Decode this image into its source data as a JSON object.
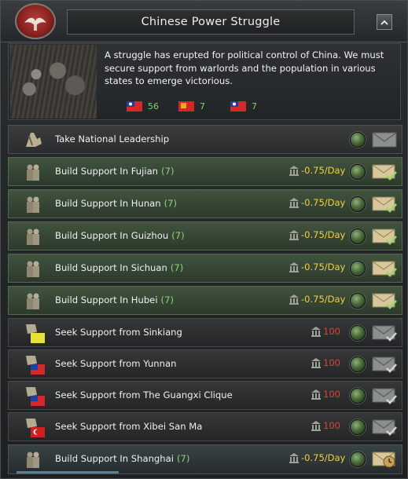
{
  "header": {
    "title": "Chinese Power Struggle",
    "emblem_icon": "faction-emblem-icon",
    "collapse_icon": "chevron-up-icon"
  },
  "description": {
    "text": "A struggle has erupted for political control of China. We must secure support from warlords and the population in various states to emerge victorious.",
    "stats": [
      {
        "flag": "roc-flag-icon",
        "value": "56"
      },
      {
        "flag": "communist-flag-icon",
        "value": "7"
      },
      {
        "flag": "roc-flag-icon",
        "value": "7"
      }
    ]
  },
  "colors": {
    "row_green": "#41533f",
    "row_gray": "#3a3c3d",
    "cost_yellow": "#f1d13e",
    "cost_red": "#e0413a",
    "days_green": "#8fd37a"
  },
  "decisions": [
    {
      "label": "Take National Leadership",
      "days": "",
      "cost": "",
      "cost_color": "",
      "icon": "leader-icon",
      "style": "gray",
      "status": "available-icon",
      "envelope": "envelope-icon"
    },
    {
      "label": "Build Support In Fujian",
      "days": "(7)",
      "cost": "-0.75/Day",
      "cost_color": "yellow",
      "icon": "soldiers-icon",
      "style": "green",
      "status": "available-icon",
      "envelope": "envelope-checked-icon"
    },
    {
      "label": "Build Support In Hunan",
      "days": "(7)",
      "cost": "-0.75/Day",
      "cost_color": "yellow",
      "icon": "soldiers-icon",
      "style": "green",
      "status": "available-icon",
      "envelope": "envelope-checked-icon"
    },
    {
      "label": "Build Support In Guizhou",
      "days": "(7)",
      "cost": "-0.75/Day",
      "cost_color": "yellow",
      "icon": "soldiers-icon",
      "style": "green",
      "status": "available-icon",
      "envelope": "envelope-checked-icon"
    },
    {
      "label": "Build Support In Sichuan",
      "days": "(7)",
      "cost": "-0.75/Day",
      "cost_color": "yellow",
      "icon": "soldiers-icon",
      "style": "green",
      "status": "available-icon",
      "envelope": "envelope-checked-icon"
    },
    {
      "label": "Build Support In Hubei",
      "days": "(7)",
      "cost": "-0.75/Day",
      "cost_color": "yellow",
      "icon": "soldiers-icon",
      "style": "green",
      "status": "available-icon",
      "envelope": "envelope-checked-icon"
    },
    {
      "label": "Seek Support from Sinkiang",
      "days": "",
      "cost": "100",
      "cost_color": "red",
      "icon": "fist-sinkiang-flag-icon",
      "style": "dark",
      "status": "available-icon",
      "envelope": "envelope-checked-icon"
    },
    {
      "label": "Seek Support from Yunnan",
      "days": "",
      "cost": "100",
      "cost_color": "red",
      "icon": "fist-yunnan-flag-icon",
      "style": "dark",
      "status": "available-icon",
      "envelope": "envelope-checked-icon"
    },
    {
      "label": "Seek Support from The Guangxi Clique",
      "days": "",
      "cost": "100",
      "cost_color": "red",
      "icon": "fist-guangxi-flag-icon",
      "style": "dark",
      "status": "available-icon",
      "envelope": "envelope-checked-icon"
    },
    {
      "label": "Seek Support from Xibei San Ma",
      "days": "",
      "cost": "100",
      "cost_color": "red",
      "icon": "fist-xibei-flag-icon",
      "style": "dark",
      "status": "available-icon",
      "envelope": "envelope-checked-icon"
    },
    {
      "label": "Build Support In Shanghai",
      "days": "(7)",
      "cost": "-0.75/Day",
      "cost_color": "yellow",
      "icon": "soldiers-icon",
      "style": "blue",
      "status": "available-icon",
      "envelope": "envelope-clock-icon",
      "progress_fraction": 0.27
    }
  ]
}
